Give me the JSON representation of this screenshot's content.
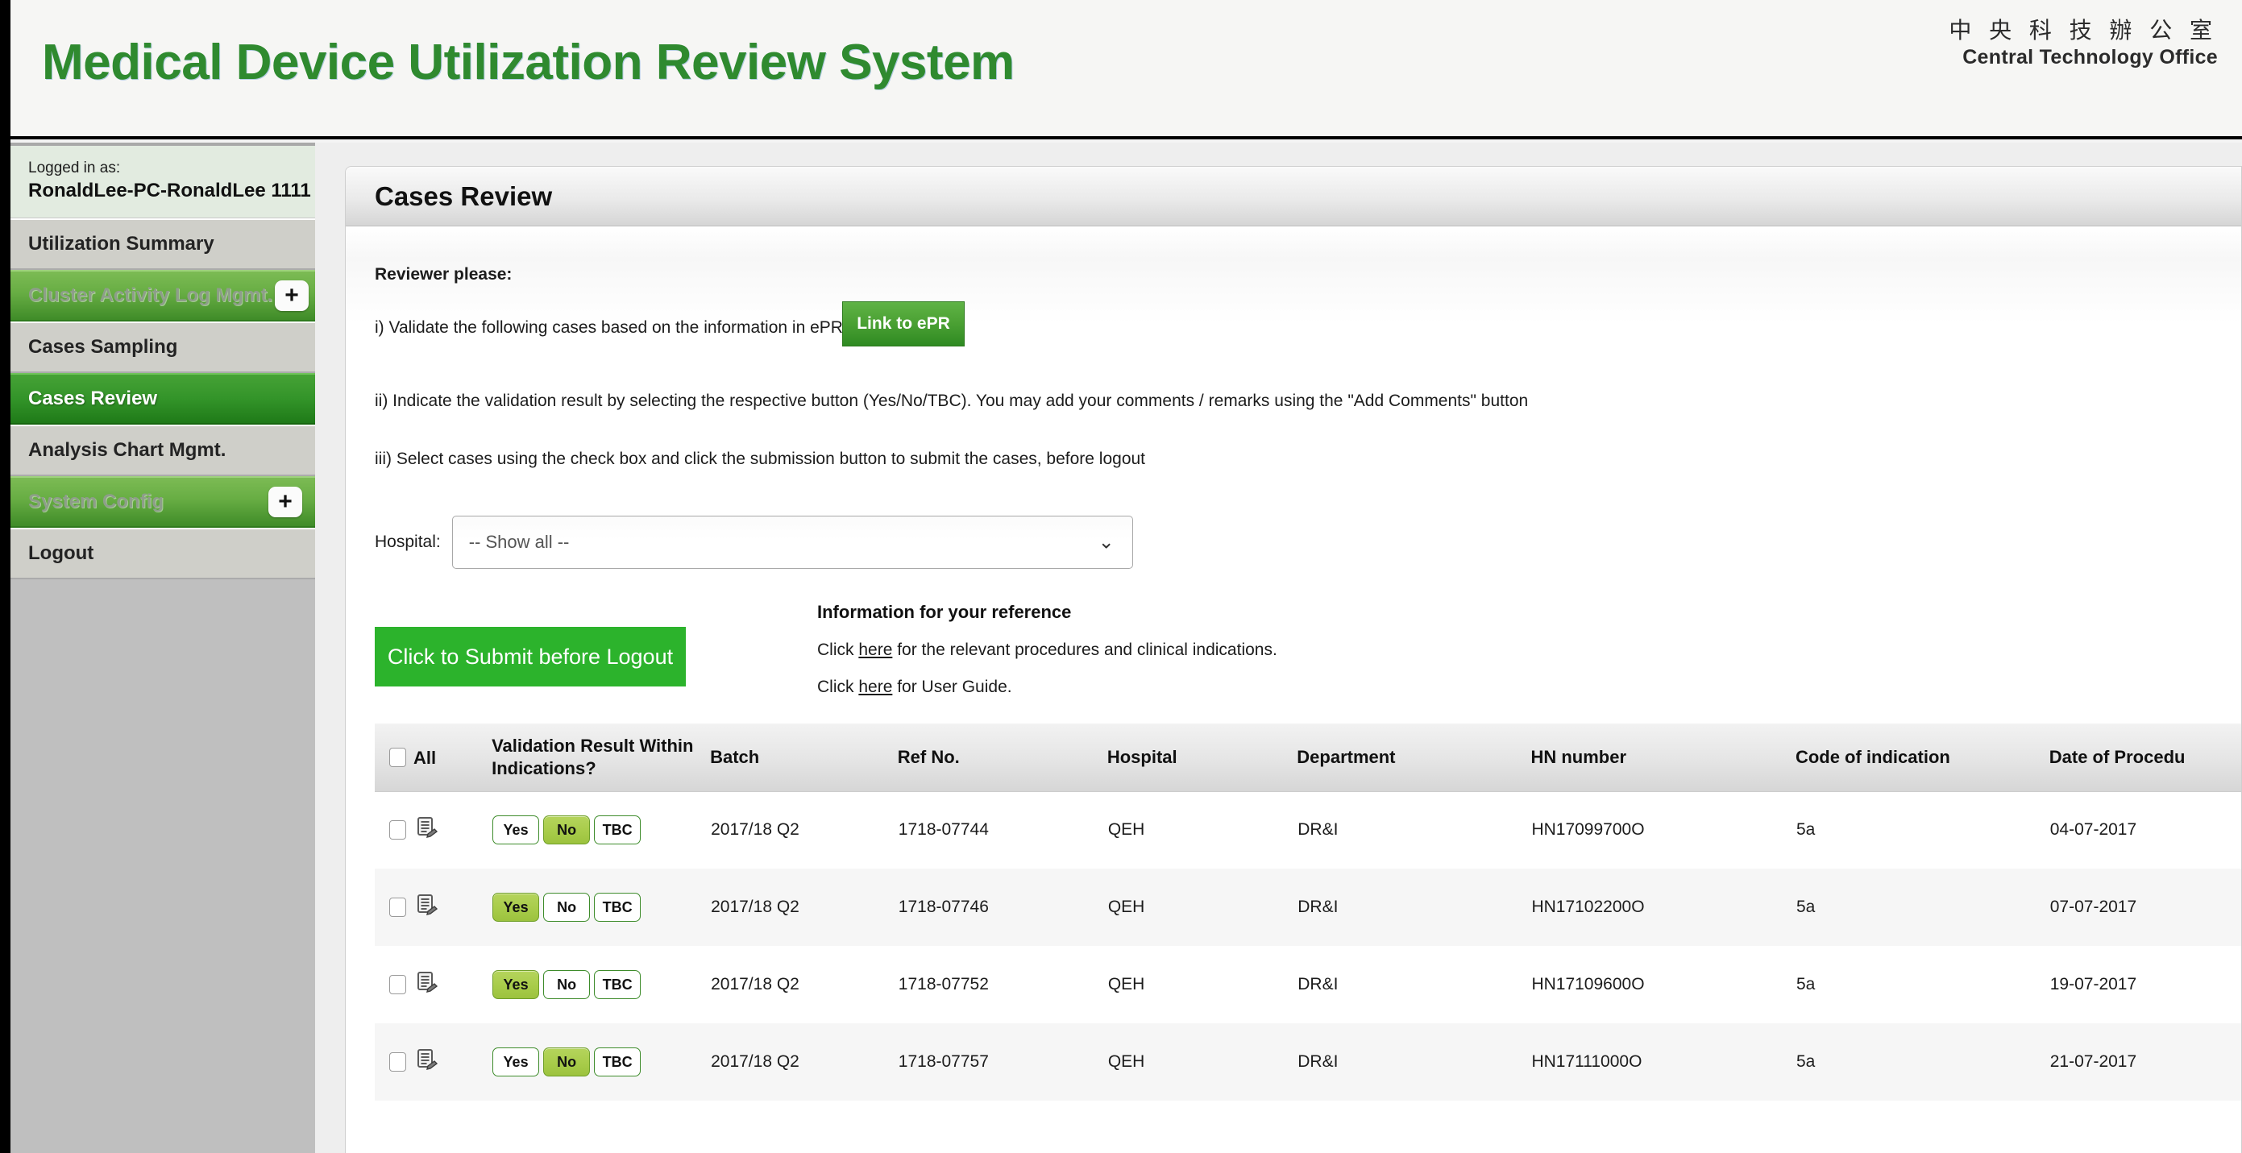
{
  "banner": {
    "title": "Medical Device Utilization Review System",
    "brand_cn": "中 央 科 技 辦 公 室",
    "brand_en": "Central Technology Office"
  },
  "sidebar": {
    "logged_in_label": "Logged in as:",
    "logged_in_user": "RonaldLee-PC-RonaldLee 1111",
    "items": [
      {
        "label": "Utilization Summary",
        "type": "plain",
        "expandable": false
      },
      {
        "label": "Cluster Activity Log Mgmt.",
        "type": "group",
        "expandable": true,
        "expand_icon": "plus-icon"
      },
      {
        "label": "Cases Sampling",
        "type": "plain",
        "expandable": false
      },
      {
        "label": "Cases Review",
        "type": "active",
        "expandable": false
      },
      {
        "label": "Analysis Chart Mgmt.",
        "type": "plain",
        "expandable": false
      },
      {
        "label": "System Config",
        "type": "group",
        "expandable": true,
        "expand_icon": "plus-icon"
      },
      {
        "label": "Logout",
        "type": "plain",
        "expandable": false
      }
    ]
  },
  "panel": {
    "title": "Cases Review",
    "instructions": {
      "heading": "Reviewer please:",
      "line1": "i) Validate the following cases based on the information in ePR",
      "line2": "ii) Indicate the validation result by selecting the respective button (Yes/No/TBC). You may add your comments / remarks using the \"Add Comments\" button",
      "line3": "iii) Select cases using the check box and click the submission button to submit the cases, before logout"
    },
    "epr_button": "Link to ePR",
    "hospital_filter": {
      "label": "Hospital:",
      "selected": "-- Show all --",
      "chevron": "chevron-down-icon"
    },
    "submit_button": "Click to Submit before Logout",
    "info": {
      "title": "Information for your reference",
      "line1_prefix": "Click ",
      "line1_link": "here",
      "line1_suffix": " for the relevant procedures and clinical indications.",
      "line2_prefix": "Click ",
      "line2_link": "here",
      "line2_suffix": " for User Guide."
    }
  },
  "table": {
    "select_all_label": "All",
    "columns": [
      "All",
      "Validation Result Within Indications?",
      "Batch",
      "Ref No.",
      "Hospital",
      "Department",
      "HN number",
      "Code of indication",
      "Date of Procedu"
    ],
    "validation_options": [
      "Yes",
      "No",
      "TBC"
    ],
    "rows": [
      {
        "checked": false,
        "note_icon": "add-comments-icon",
        "validation": "No",
        "batch": "2017/18 Q2",
        "ref_no": "1718-07744",
        "hospital": "QEH",
        "department": "DR&I",
        "hn_number": "HN17099700O",
        "code_of_indication": "5a",
        "date_of_procedure": "04-07-2017"
      },
      {
        "checked": false,
        "note_icon": "add-comments-icon",
        "validation": "Yes",
        "batch": "2017/18 Q2",
        "ref_no": "1718-07746",
        "hospital": "QEH",
        "department": "DR&I",
        "hn_number": "HN17102200O",
        "code_of_indication": "5a",
        "date_of_procedure": "07-07-2017"
      },
      {
        "checked": false,
        "note_icon": "add-comments-icon",
        "validation": "Yes",
        "batch": "2017/18 Q2",
        "ref_no": "1718-07752",
        "hospital": "QEH",
        "department": "DR&I",
        "hn_number": "HN17109600O",
        "code_of_indication": "5a",
        "date_of_procedure": "19-07-2017"
      },
      {
        "checked": false,
        "note_icon": "add-comments-icon",
        "validation": "No",
        "batch": "2017/18 Q2",
        "ref_no": "1718-07757",
        "hospital": "QEH",
        "department": "DR&I",
        "hn_number": "HN17111000O",
        "code_of_indication": "5a",
        "date_of_procedure": "21-07-2017"
      }
    ]
  },
  "colors": {
    "brand_green": "#2f8a2f",
    "active_nav_green": "#2b8a22",
    "submit_green": "#2cb32c",
    "selected_option": "#a8cc4a"
  }
}
